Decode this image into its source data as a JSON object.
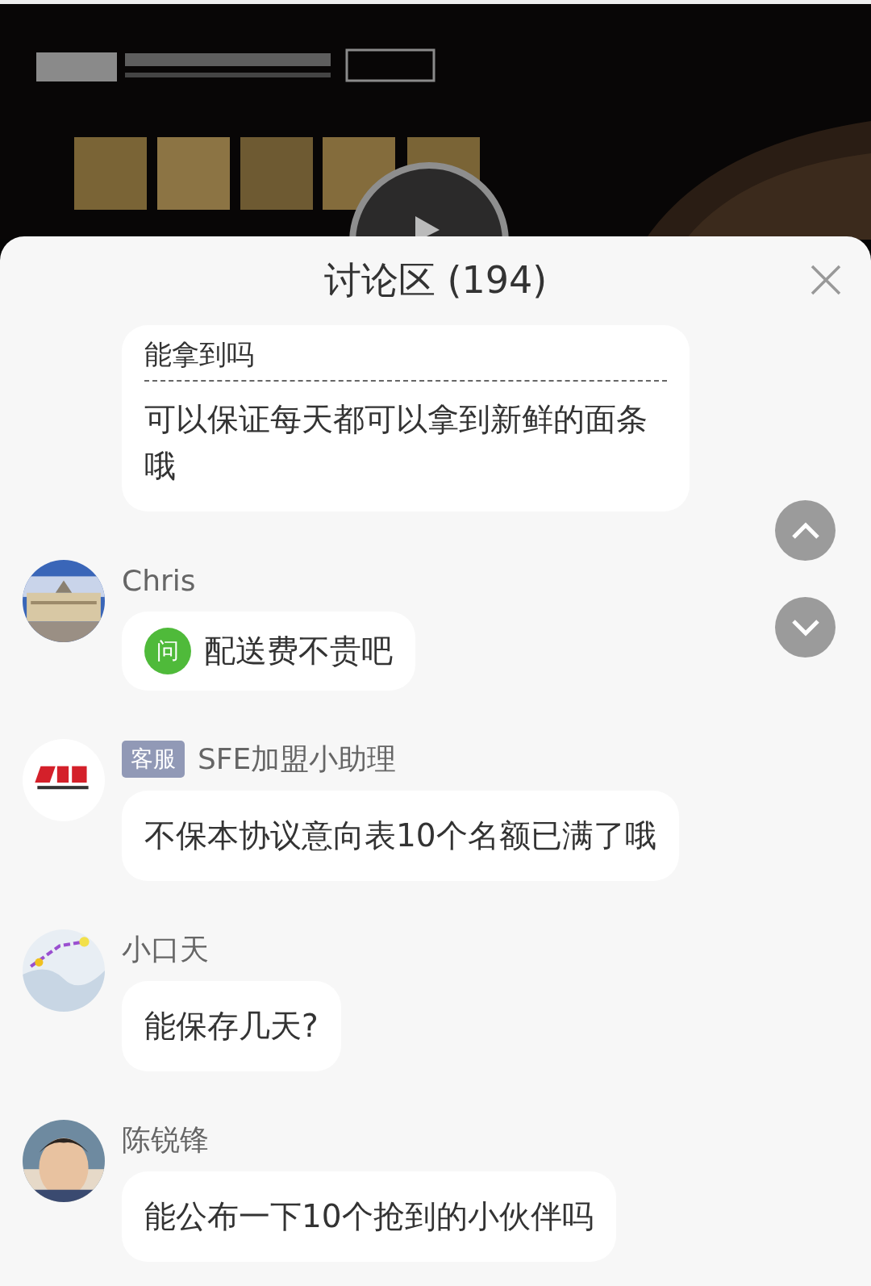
{
  "panel": {
    "title": "讨论区 (194)"
  },
  "messages": [
    {
      "kind": "reply",
      "quote": "能拿到吗",
      "text": "可以保证每天都可以拿到新鲜的面条哦"
    },
    {
      "kind": "question",
      "name": "Chris",
      "badge": "问",
      "text": "配送费不贵吧"
    },
    {
      "kind": "plain",
      "name": "SFE加盟小助理",
      "avatar": {
        "kind": "logo"
      },
      "tag": "客服",
      "text": "不保本协议意向表10个名额已满了哦"
    },
    {
      "kind": "plain",
      "name": "小口天",
      "text": "能保存几天?"
    },
    {
      "kind": "plain",
      "name": "陈锐锋",
      "text": "能公布一下10个抢到的小伙伴吗"
    }
  ]
}
